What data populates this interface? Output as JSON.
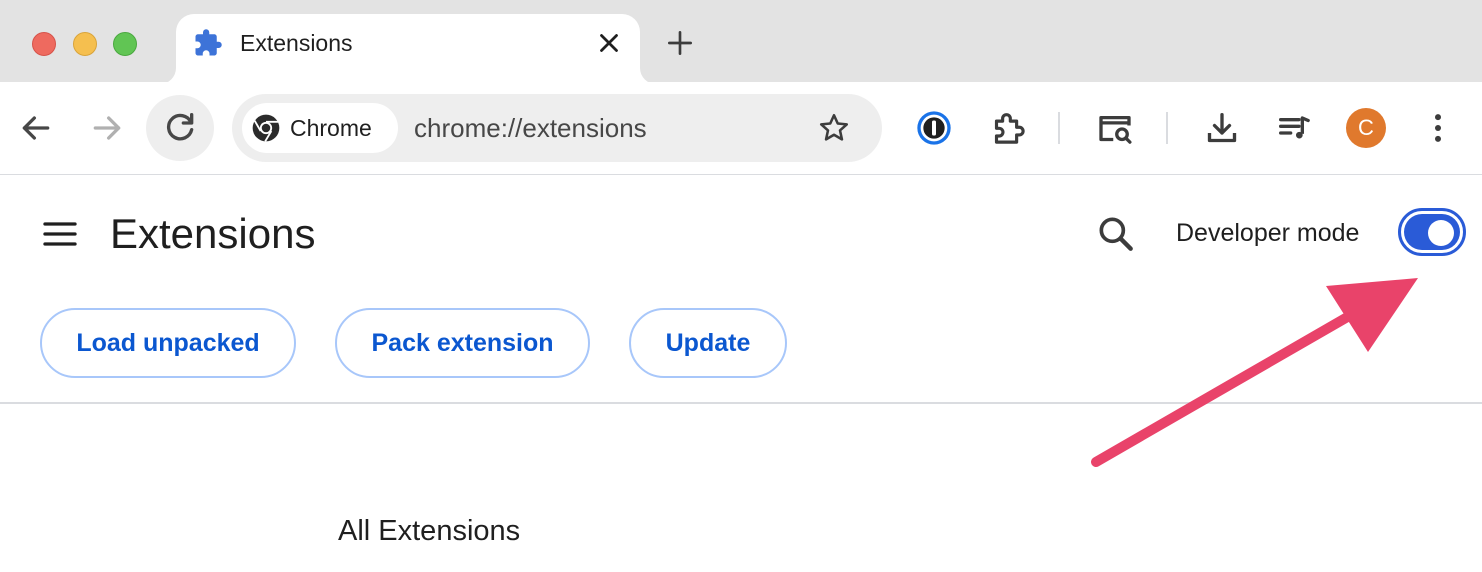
{
  "window": {
    "tab_title": "Extensions",
    "tab_icon": "puzzle-icon",
    "close_icon": "close-icon",
    "new_tab_icon": "plus-icon"
  },
  "toolbar": {
    "chip_label": "Chrome",
    "url": "chrome://extensions",
    "avatar_letter": "C",
    "avatar_color": "#e0792d"
  },
  "page": {
    "title": "Extensions",
    "developer_mode_label": "Developer mode",
    "developer_mode_on": true,
    "buttons": {
      "load_unpacked": "Load unpacked",
      "pack_extension": "Pack extension",
      "update": "Update"
    },
    "section_title": "All Extensions"
  },
  "colors": {
    "accent": "#0b57d0",
    "toggle": "#2a5bd7",
    "annotation_arrow": "#e9436a"
  }
}
